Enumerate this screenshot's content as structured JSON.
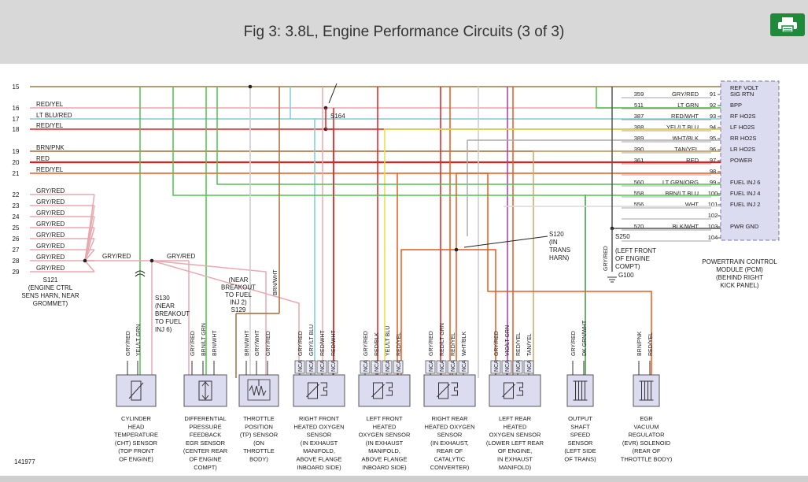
{
  "header": {
    "title": "Fig 3: 3.8L, Engine Performance Circuits (3 of 3)",
    "print_icon": "printer-icon"
  },
  "colors": {
    "header_bg": "#d8d8d8",
    "print_button": "#1f8a3a",
    "pcm_box": "#dcdcf0"
  },
  "diagram": {
    "left_rows": [
      {
        "num": "15",
        "label": ""
      },
      {
        "num": "16",
        "label": "RED/YEL"
      },
      {
        "num": "17",
        "label": "LT BLU/RED"
      },
      {
        "num": "18",
        "label": "RED/YEL"
      },
      {
        "num": "19",
        "label": "BRN/PNK"
      },
      {
        "num": "20",
        "label": "RED"
      },
      {
        "num": "21",
        "label": "RED/YEL"
      },
      {
        "num": "22",
        "label": "GRY/RED"
      },
      {
        "num": "23",
        "label": "GRY/RED"
      },
      {
        "num": "24",
        "label": "GRY/RED"
      },
      {
        "num": "25",
        "label": "GRY/RED"
      },
      {
        "num": "26",
        "label": "GRY/RED"
      },
      {
        "num": "27",
        "label": "GRY/RED"
      },
      {
        "num": "28",
        "label": "GRY/RED"
      },
      {
        "num": "29",
        "label": "GRY/RED"
      }
    ],
    "pcm_rows": [
      {
        "circuit": "359",
        "color": "GRY/RED",
        "pin": "91",
        "func": "SIG RTN"
      },
      {
        "circuit": "511",
        "color": "LT GRN",
        "pin": "92",
        "func": "BPP"
      },
      {
        "circuit": "387",
        "color": "RED/WHT",
        "pin": "93",
        "func": "RF HO2S"
      },
      {
        "circuit": "388",
        "color": "YEL/LT BLU",
        "pin": "94",
        "func": "LF HO2S"
      },
      {
        "circuit": "389",
        "color": "WHT/BLK",
        "pin": "95",
        "func": "RR HO2S"
      },
      {
        "circuit": "390",
        "color": "TAN/YEL",
        "pin": "96",
        "func": "LR HO2S"
      },
      {
        "circuit": "361",
        "color": "RED",
        "pin": "97",
        "func": "POWER"
      },
      {
        "circuit": "",
        "color": "",
        "pin": "98",
        "func": ""
      },
      {
        "circuit": "560",
        "color": "LT GRN/ORG",
        "pin": "99",
        "func": "FUEL INJ 6"
      },
      {
        "circuit": "558",
        "color": "BRN/LT BLU",
        "pin": "100",
        "func": "FUEL INJ 4"
      },
      {
        "circuit": "556",
        "color": "WHT",
        "pin": "101",
        "func": "FUEL INJ 2"
      },
      {
        "circuit": "",
        "color": "",
        "pin": "102",
        "func": ""
      },
      {
        "circuit": "570",
        "color": "BLK/WHT",
        "pin": "103",
        "func": "PWR GND"
      },
      {
        "circuit": "",
        "color": "",
        "pin": "104",
        "func": ""
      }
    ],
    "pcm_ref_volt": "REF VOLT",
    "pcm_label": [
      "POWERTRAIN CONTROL",
      "MODULE (PCM)",
      "(BEHIND RIGHT",
      "KICK PANEL)"
    ],
    "splices": {
      "s164": "S164",
      "s121": [
        "S121",
        "(ENGINE CTRL",
        "SENS HARN, NEAR",
        "GROMMET)"
      ],
      "s130": [
        "S130",
        "(NEAR",
        "BREAKOUT",
        "TO FUEL",
        "INJ 6)"
      ],
      "s129": [
        "(NEAR",
        "BREAKOUT",
        "TO FUEL",
        "INJ 2)",
        "S129"
      ],
      "s120": [
        "S120",
        "(IN",
        "TRANS",
        "HARN)"
      ],
      "s250": [
        "S250",
        "(LEFT FRONT",
        "OF ENGINE",
        "COMPT)",
        "G100"
      ]
    },
    "mid_labels": {
      "s121_out": "GRY/RED",
      "s130_out": "GRY/RED",
      "s129_up": "BRN/WHT",
      "s250_up": "GRY/RED"
    },
    "components": [
      {
        "wires": [
          "GRY/RED",
          "YEL/LT GRN"
        ],
        "label": [
          "CYLINDER",
          "HEAD",
          "TEMPERATURE",
          "(CHT) SENSOR",
          "(TOP FRONT",
          "OF ENGINE)"
        ]
      },
      {
        "wires": [
          "GRY/RED",
          "BRN/LT GRN",
          "BRN/WHT"
        ],
        "label": [
          "DIFFERENTIAL",
          "PRESSURE",
          "FEEDBACK",
          "EGR SENSOR",
          "(CENTER REAR",
          "OF ENGINE",
          "COMPT)"
        ]
      },
      {
        "wires": [
          "BRN/WHT",
          "GRY/WHT",
          "GRY/RED"
        ],
        "label": [
          "THROTTLE",
          "POSITION",
          "(TP) SENSOR",
          "(ON",
          "THROTTLE",
          "BODY)"
        ]
      },
      {
        "wires": [
          "GRY/RED",
          "GRY/LT BLU",
          "RED/WHT",
          "RED/WHT"
        ],
        "label": [
          "RIGHT FRONT",
          "HEATED OXYGEN",
          "SENSOR",
          "(IN EXHAUST",
          "MANIFOLD,",
          "ABOVE FLANGE",
          "INBOARD SIDE)"
        ]
      },
      {
        "wires": [
          "GRY/RED",
          "RED/BLK",
          "YEL/LT BLU",
          "RED/YEL"
        ],
        "label": [
          "LEFT FRONT",
          "HEATED",
          "OXYGEN SENSOR",
          "(IN EXHAUST",
          "MANIFOLD,",
          "ABOVE FLANGE",
          "INBOARD SIDE)"
        ]
      },
      {
        "wires": [
          "GRY/RED",
          "RED/LT GRN",
          "RED/YEL",
          "WHT/BLK"
        ],
        "label": [
          "RIGHT REAR",
          "HEATED OXYGEN",
          "SENSOR",
          "(IN EXHAUST,",
          "REAR OF",
          "CATALYTIC",
          "CONVERTER)"
        ]
      },
      {
        "wires": [
          "GRY/RED",
          "VIO/LT GRN",
          "RED/YEL",
          "TAN/YEL"
        ],
        "label": [
          "LEFT REAR",
          "HEATED",
          "OXYGEN SENSOR",
          "(LOWER LEFT REAR",
          "OF ENGINE,",
          "IN EXHAUST",
          "MANIFOLD)"
        ]
      },
      {
        "wires": [
          "GRY/RED",
          "DK GRN/WHT"
        ],
        "label": [
          "OUTPUT",
          "SHAFT",
          "SPEED",
          "SENSOR",
          "(LEFT SIDE",
          "OF TRANS)"
        ]
      },
      {
        "wires": [
          "BRN/PNK",
          "RED/YEL"
        ],
        "label": [
          "EGR",
          "VACUUM",
          "REGULATOR",
          "(EVR) SOLENOID",
          "(REAR OF",
          "THROTTLE BODY)"
        ]
      }
    ],
    "nca": "NCA",
    "fig_number": "141977"
  }
}
